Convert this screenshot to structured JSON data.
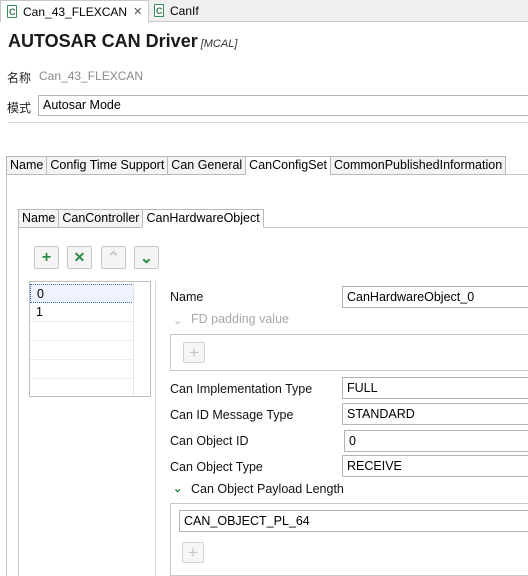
{
  "editor_tabs": [
    {
      "label": "Can_43_FLEXCAN",
      "active": true,
      "closable": true,
      "icon": "config-file-icon"
    },
    {
      "label": "CanIf",
      "active": false,
      "closable": false,
      "icon": "config-file-icon"
    }
  ],
  "header": {
    "title": "AUTOSAR CAN Driver",
    "subtitle": "[MCAL]"
  },
  "name_row": {
    "label": "名称",
    "value": "Can_43_FLEXCAN"
  },
  "mode_row": {
    "label": "模式",
    "value": "Autosar Mode"
  },
  "main_tabs": [
    "Name",
    "Config Time Support",
    "Can General",
    "CanConfigSet",
    "CommonPublishedInformation"
  ],
  "main_tab_active": "CanConfigSet",
  "sub_tabs": [
    "Name",
    "CanController",
    "CanHardwareObject"
  ],
  "sub_tab_active": "CanHardwareObject",
  "toolbar": {
    "add": "+",
    "remove": "✕",
    "move_up": "⌃",
    "move_down": "⌄"
  },
  "list_items": [
    "0",
    "1"
  ],
  "list_selected": "0",
  "form": {
    "name_label": "Name",
    "name_value": "CanHardwareObject_0",
    "fd_padding_label": "FD padding value",
    "impl_type_label": "Can Implementation Type",
    "impl_type_value": "FULL",
    "id_msg_type_label": "Can ID Message Type",
    "id_msg_type_value": "STANDARD",
    "object_id_label": "Can Object ID",
    "object_id_value": "0",
    "object_type_label": "Can Object Type",
    "object_type_value": "RECEIVE",
    "payload_label": "Can Object Payload Length",
    "payload_value": "CAN_OBJECT_PL_64"
  },
  "colors": {
    "accent_green": "#2a8a4a",
    "selection_border": "#3a63c4",
    "disabled_text": "#a9a9a9"
  }
}
